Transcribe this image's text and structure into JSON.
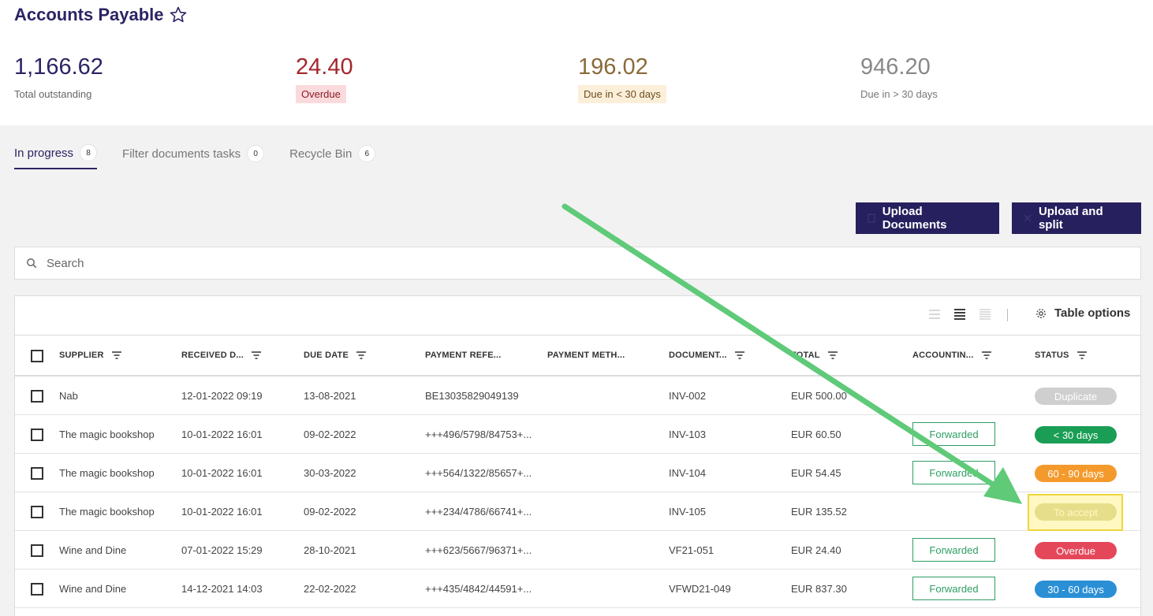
{
  "header": {
    "title": "Accounts Payable"
  },
  "kpis": {
    "total": {
      "value": "1,166.62",
      "label": "Total outstanding"
    },
    "overdue": {
      "value": "24.40",
      "label": "Overdue"
    },
    "due_lt30": {
      "value": "196.02",
      "label": "Due in < 30 days"
    },
    "due_gt30": {
      "value": "946.20",
      "label": "Due in > 30 days"
    }
  },
  "tabs": [
    {
      "label": "In progress",
      "count": "8"
    },
    {
      "label": "Filter documents tasks",
      "count": "0"
    },
    {
      "label": "Recycle Bin",
      "count": "6"
    }
  ],
  "actions": {
    "upload": "Upload Documents",
    "split": "Upload and split"
  },
  "search": {
    "placeholder": "Search"
  },
  "toolbar": {
    "table_options": "Table options"
  },
  "columns": {
    "supplier": "SUPPLIER",
    "received": "RECEIVED D...",
    "due": "DUE DATE",
    "payment_ref": "PAYMENT REFE...",
    "payment_method": "PAYMENT METH...",
    "document": "DOCUMENT...",
    "total": "TOTAL",
    "accounting": "ACCOUNTIN...",
    "status": "STATUS"
  },
  "rows": [
    {
      "supplier": "Nab",
      "received": "12-01-2022 09:19",
      "due": "13-08-2021",
      "ref": "BE13035829049139",
      "doc": "INV-002",
      "total": "EUR 500.00",
      "accounting": "",
      "status": "Duplicate"
    },
    {
      "supplier": "The magic bookshop",
      "received": "10-01-2022 16:01",
      "due": "09-02-2022",
      "ref": "+++496/5798/84753+...",
      "doc": "INV-103",
      "total": "EUR 60.50",
      "accounting": "Forwarded",
      "status": "< 30 days"
    },
    {
      "supplier": "The magic bookshop",
      "received": "10-01-2022 16:01",
      "due": "30-03-2022",
      "ref": "+++564/1322/85657+...",
      "doc": "INV-104",
      "total": "EUR 54.45",
      "accounting": "Forwarded",
      "status": "60 - 90 days"
    },
    {
      "supplier": "The magic bookshop",
      "received": "10-01-2022 16:01",
      "due": "09-02-2022",
      "ref": "+++234/4786/66741+...",
      "doc": "INV-105",
      "total": "EUR 135.52",
      "accounting": "",
      "status": "To accept"
    },
    {
      "supplier": "Wine and Dine",
      "received": "07-01-2022 15:29",
      "due": "28-10-2021",
      "ref": "+++623/5667/96371+...",
      "doc": "VF21-051",
      "total": "EUR 24.40",
      "accounting": "Forwarded",
      "status": "Overdue"
    },
    {
      "supplier": "Wine and Dine",
      "received": "14-12-2021 14:03",
      "due": "22-02-2022",
      "ref": "+++435/4842/44591+...",
      "doc": "VFWD21-049",
      "total": "EUR 837.30",
      "accounting": "Forwarded",
      "status": "30 - 60 days"
    }
  ],
  "status_colors": {
    "Duplicate": "#cfcfcf",
    "< 30 days": "#1a9e55",
    "60 - 90 days": "#f49a2c",
    "To accept": "#d4cf9b",
    "Overdue": "#e5475a",
    "30 - 60 days": "#2b8fd6"
  }
}
